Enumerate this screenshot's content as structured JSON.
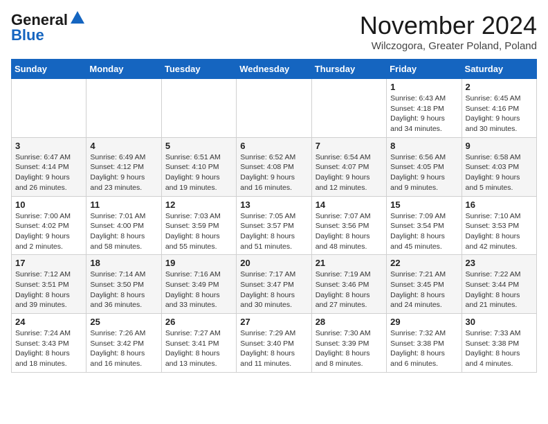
{
  "header": {
    "logo_general": "General",
    "logo_blue": "Blue",
    "title": "November 2024",
    "location": "Wilczogora, Greater Poland, Poland"
  },
  "days_of_week": [
    "Sunday",
    "Monday",
    "Tuesday",
    "Wednesday",
    "Thursday",
    "Friday",
    "Saturday"
  ],
  "weeks": [
    [
      {
        "day": "",
        "info": ""
      },
      {
        "day": "",
        "info": ""
      },
      {
        "day": "",
        "info": ""
      },
      {
        "day": "",
        "info": ""
      },
      {
        "day": "",
        "info": ""
      },
      {
        "day": "1",
        "info": "Sunrise: 6:43 AM\nSunset: 4:18 PM\nDaylight: 9 hours\nand 34 minutes."
      },
      {
        "day": "2",
        "info": "Sunrise: 6:45 AM\nSunset: 4:16 PM\nDaylight: 9 hours\nand 30 minutes."
      }
    ],
    [
      {
        "day": "3",
        "info": "Sunrise: 6:47 AM\nSunset: 4:14 PM\nDaylight: 9 hours\nand 26 minutes."
      },
      {
        "day": "4",
        "info": "Sunrise: 6:49 AM\nSunset: 4:12 PM\nDaylight: 9 hours\nand 23 minutes."
      },
      {
        "day": "5",
        "info": "Sunrise: 6:51 AM\nSunset: 4:10 PM\nDaylight: 9 hours\nand 19 minutes."
      },
      {
        "day": "6",
        "info": "Sunrise: 6:52 AM\nSunset: 4:08 PM\nDaylight: 9 hours\nand 16 minutes."
      },
      {
        "day": "7",
        "info": "Sunrise: 6:54 AM\nSunset: 4:07 PM\nDaylight: 9 hours\nand 12 minutes."
      },
      {
        "day": "8",
        "info": "Sunrise: 6:56 AM\nSunset: 4:05 PM\nDaylight: 9 hours\nand 9 minutes."
      },
      {
        "day": "9",
        "info": "Sunrise: 6:58 AM\nSunset: 4:03 PM\nDaylight: 9 hours\nand 5 minutes."
      }
    ],
    [
      {
        "day": "10",
        "info": "Sunrise: 7:00 AM\nSunset: 4:02 PM\nDaylight: 9 hours\nand 2 minutes."
      },
      {
        "day": "11",
        "info": "Sunrise: 7:01 AM\nSunset: 4:00 PM\nDaylight: 8 hours\nand 58 minutes."
      },
      {
        "day": "12",
        "info": "Sunrise: 7:03 AM\nSunset: 3:59 PM\nDaylight: 8 hours\nand 55 minutes."
      },
      {
        "day": "13",
        "info": "Sunrise: 7:05 AM\nSunset: 3:57 PM\nDaylight: 8 hours\nand 51 minutes."
      },
      {
        "day": "14",
        "info": "Sunrise: 7:07 AM\nSunset: 3:56 PM\nDaylight: 8 hours\nand 48 minutes."
      },
      {
        "day": "15",
        "info": "Sunrise: 7:09 AM\nSunset: 3:54 PM\nDaylight: 8 hours\nand 45 minutes."
      },
      {
        "day": "16",
        "info": "Sunrise: 7:10 AM\nSunset: 3:53 PM\nDaylight: 8 hours\nand 42 minutes."
      }
    ],
    [
      {
        "day": "17",
        "info": "Sunrise: 7:12 AM\nSunset: 3:51 PM\nDaylight: 8 hours\nand 39 minutes."
      },
      {
        "day": "18",
        "info": "Sunrise: 7:14 AM\nSunset: 3:50 PM\nDaylight: 8 hours\nand 36 minutes."
      },
      {
        "day": "19",
        "info": "Sunrise: 7:16 AM\nSunset: 3:49 PM\nDaylight: 8 hours\nand 33 minutes."
      },
      {
        "day": "20",
        "info": "Sunrise: 7:17 AM\nSunset: 3:47 PM\nDaylight: 8 hours\nand 30 minutes."
      },
      {
        "day": "21",
        "info": "Sunrise: 7:19 AM\nSunset: 3:46 PM\nDaylight: 8 hours\nand 27 minutes."
      },
      {
        "day": "22",
        "info": "Sunrise: 7:21 AM\nSunset: 3:45 PM\nDaylight: 8 hours\nand 24 minutes."
      },
      {
        "day": "23",
        "info": "Sunrise: 7:22 AM\nSunset: 3:44 PM\nDaylight: 8 hours\nand 21 minutes."
      }
    ],
    [
      {
        "day": "24",
        "info": "Sunrise: 7:24 AM\nSunset: 3:43 PM\nDaylight: 8 hours\nand 18 minutes."
      },
      {
        "day": "25",
        "info": "Sunrise: 7:26 AM\nSunset: 3:42 PM\nDaylight: 8 hours\nand 16 minutes."
      },
      {
        "day": "26",
        "info": "Sunrise: 7:27 AM\nSunset: 3:41 PM\nDaylight: 8 hours\nand 13 minutes."
      },
      {
        "day": "27",
        "info": "Sunrise: 7:29 AM\nSunset: 3:40 PM\nDaylight: 8 hours\nand 11 minutes."
      },
      {
        "day": "28",
        "info": "Sunrise: 7:30 AM\nSunset: 3:39 PM\nDaylight: 8 hours\nand 8 minutes."
      },
      {
        "day": "29",
        "info": "Sunrise: 7:32 AM\nSunset: 3:38 PM\nDaylight: 8 hours\nand 6 minutes."
      },
      {
        "day": "30",
        "info": "Sunrise: 7:33 AM\nSunset: 3:38 PM\nDaylight: 8 hours\nand 4 minutes."
      }
    ]
  ]
}
